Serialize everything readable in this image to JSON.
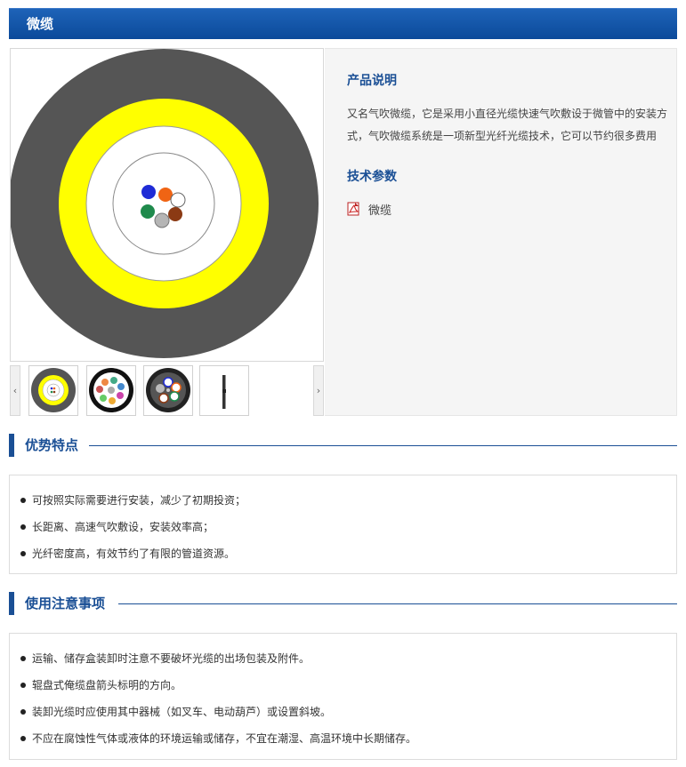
{
  "header": {
    "title": "微缆"
  },
  "gallery": {
    "main_image": {
      "description": "cross-section illustration of micro cable",
      "colors": {
        "jacket": "#555555",
        "layer": "#ffff00",
        "core_bg": "#ffffff",
        "fibers": [
          "#1f2bd6",
          "#f06414",
          "#ffffff",
          "#1f8a4c",
          "#b5b5b5",
          "#8b3a14"
        ]
      }
    },
    "prev_arrow": "‹",
    "next_arrow": "›",
    "thumbnails": [
      {
        "name": "thumb-1"
      },
      {
        "name": "thumb-2"
      },
      {
        "name": "thumb-3"
      },
      {
        "name": "thumb-4"
      }
    ]
  },
  "product": {
    "desc_heading": "产品说明",
    "desc_text": "又名气吹微缆，它是采用小直径光缆快速气吹敷设于微管中的安装方式，气吹微缆系统是一项新型光纤光缆技术，它可以节约很多费用",
    "params_heading": "技术参数",
    "pdf_label": "微缆",
    "pdf_icon": "pdf-icon"
  },
  "advantages": {
    "title": "优势特点",
    "items": [
      "可按照实际需要进行安装，减少了初期投资；",
      "长距离、高速气吹敷设，安装效率高；",
      "光纤密度高，有效节约了有限的管道资源。"
    ]
  },
  "notes": {
    "title": "使用注意事项",
    "items": [
      "运输、储存盒装卸时注意不要破坏光缆的出场包装及附件。",
      "辊盘式俺缆盘箭头标明的方向。",
      "装卸光缆时应使用其中器械（如叉车、电动葫芦）或设置斜坡。",
      "不应在腐蚀性气体或液体的环境运输或储存，不宜在潮湿、高温环境中长期储存。"
    ]
  },
  "accent_color": "#1a4f95"
}
